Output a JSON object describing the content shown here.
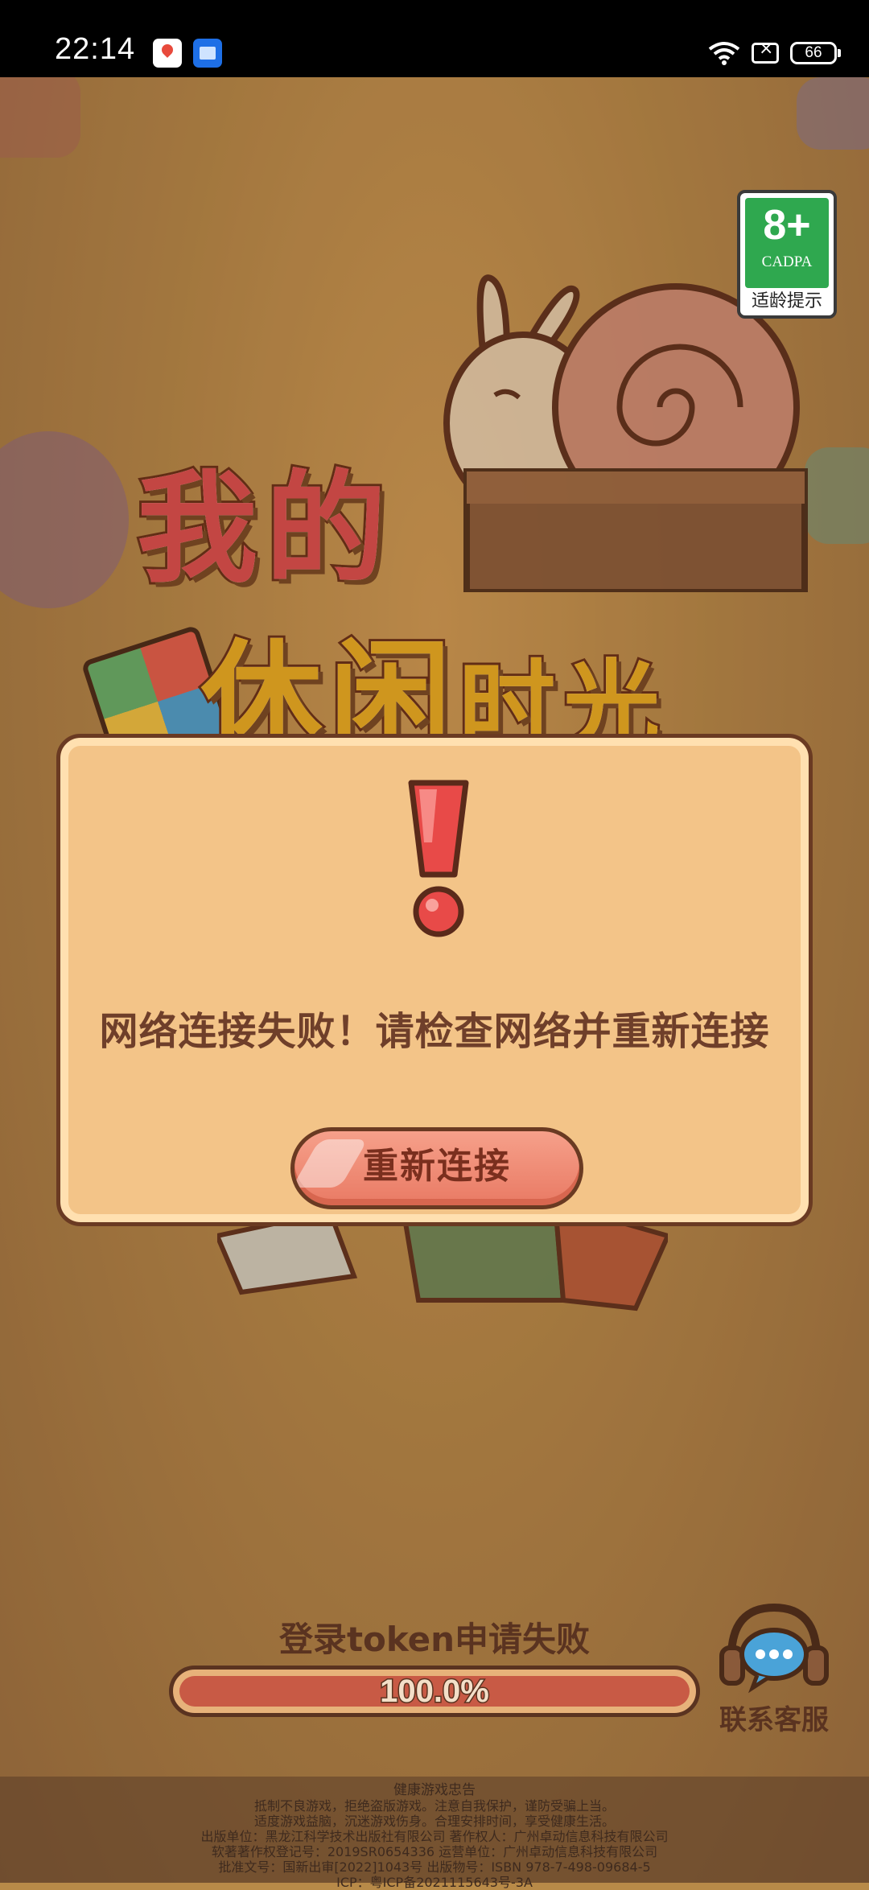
{
  "status_bar": {
    "time": "22:14",
    "battery": "66",
    "icons": [
      "maps-app-icon",
      "files-app-icon",
      "wifi-icon",
      "no-sim-icon",
      "battery-icon"
    ]
  },
  "age_rating": {
    "age": "8+",
    "org": "CADPA",
    "tip": "适龄提示"
  },
  "logo": {
    "line1": "我的",
    "line2_a": "休闲",
    "line2_b": "时光"
  },
  "dialog": {
    "message": "网络连接失败！请检查网络并重新连接",
    "button_label": "重新连接",
    "icon": "exclamation-icon"
  },
  "loading": {
    "status": "登录token申请失败",
    "percent_text": "100.0%",
    "progress": 1.0
  },
  "support": {
    "label": "联系客服",
    "icon": "headset-chat-icon"
  },
  "footer": {
    "title": "健康游戏忠告",
    "lines": [
      "抵制不良游戏，拒绝盗版游戏。注意自我保护，谨防受骗上当。",
      "适度游戏益脑，沉迷游戏伤身。合理安排时间，享受健康生活。",
      "出版单位：黑龙江科学技术出版社有限公司    著作权人：广州卓动信息科技有限公司",
      "软著著作权登记号：2019SR0654336    运营单位：广州卓动信息科技有限公司",
      "批准文号：国新出审[2022]1043号    出版物号：ISBN 978-7-498-09684-5",
      "ICP：粤ICP备2021115643号-3A"
    ]
  },
  "colors": {
    "background": "#b88a48",
    "dialog_bg": "#f3c488",
    "button": "#ef8b74",
    "outline": "#6a3a22",
    "logo_red": "#e14f4f",
    "logo_yellow": "#f0b022"
  }
}
